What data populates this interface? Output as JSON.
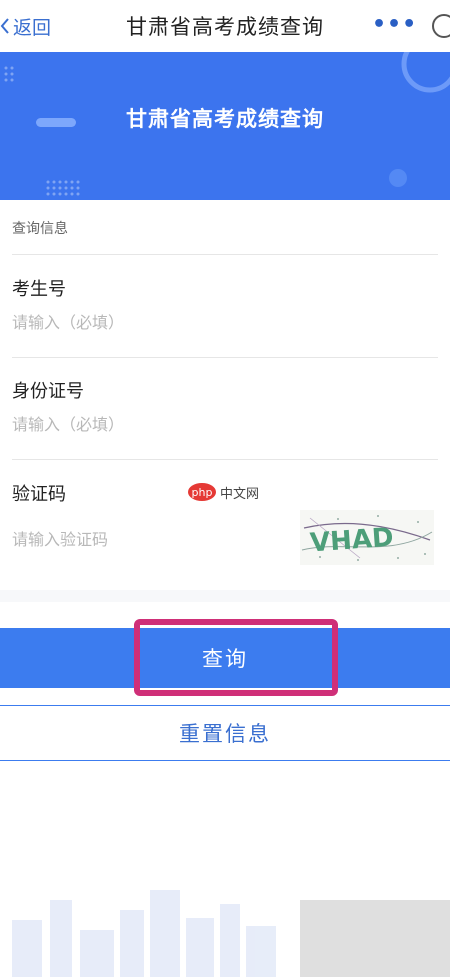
{
  "nav": {
    "back_label": "返回",
    "title": "甘肃省高考成绩查询",
    "more_label": "•••"
  },
  "banner": {
    "title": "甘肃省高考成绩查询",
    "color": "#3c74ee"
  },
  "form": {
    "section_label": "查询信息",
    "fields": [
      {
        "label": "考生号",
        "placeholder": "请输入（必填）",
        "value": ""
      },
      {
        "label": "身份证号",
        "placeholder": "请输入（必填）",
        "value": ""
      },
      {
        "label": "验证码",
        "placeholder": "请输入验证码",
        "value": ""
      }
    ],
    "captcha_text": "VHAD"
  },
  "watermark": {
    "logo_text": "php",
    "site_text": "中文网"
  },
  "actions": {
    "query_label": "查询",
    "reset_label": "重置信息",
    "accent_color": "#3c7cef",
    "highlight_color": "#cf2f78"
  }
}
